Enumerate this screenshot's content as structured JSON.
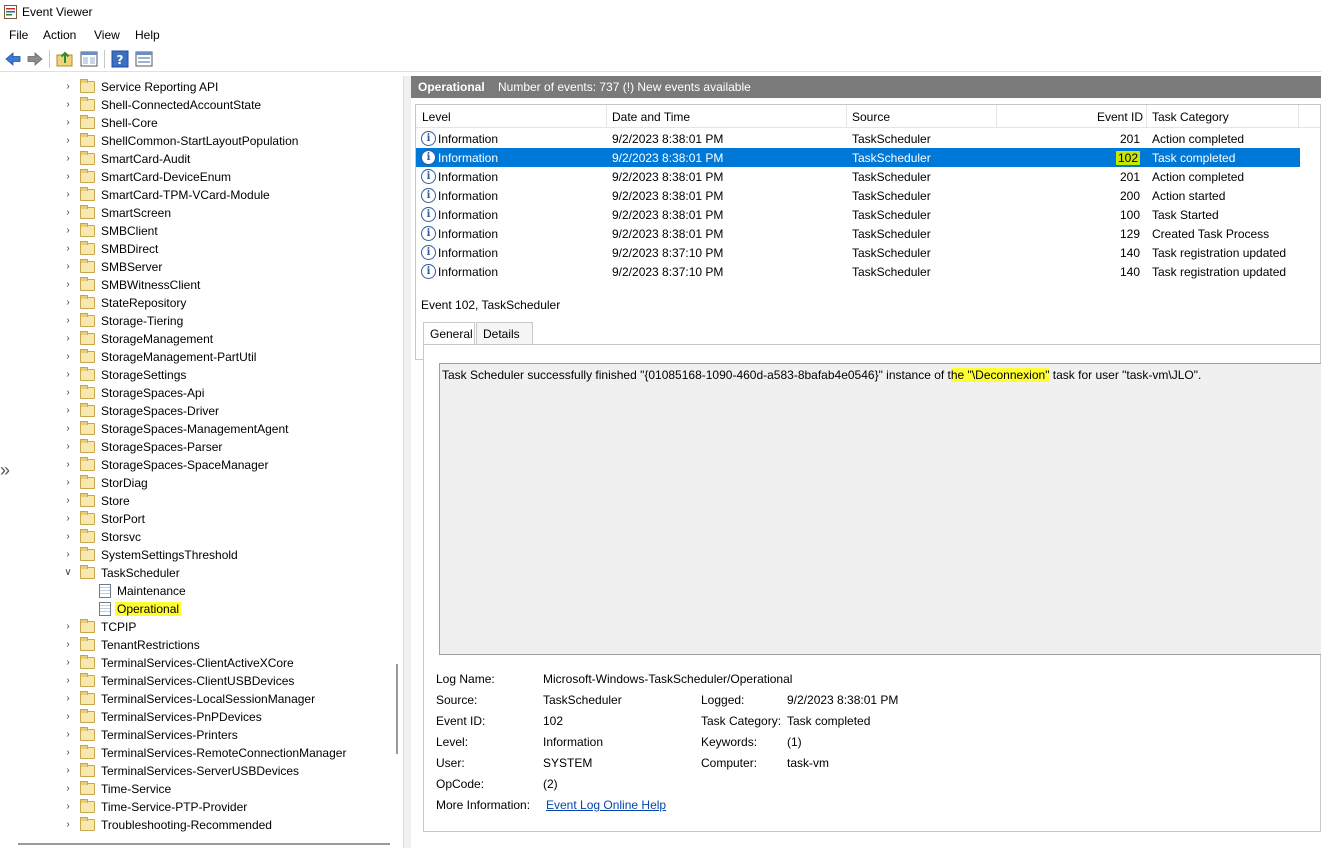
{
  "window": {
    "title": "Event Viewer"
  },
  "menu": [
    "File",
    "Action",
    "View",
    "Help"
  ],
  "toolbar": {
    "icons": [
      "back-arrow-icon",
      "forward-arrow-icon",
      "folder-up-icon",
      "properties-panel-icon",
      "help-icon",
      "show-pane-icon"
    ]
  },
  "tree": {
    "items": [
      {
        "label": "Service Reporting API",
        "expanded": false
      },
      {
        "label": "Shell-ConnectedAccountState",
        "expanded": false
      },
      {
        "label": "Shell-Core",
        "expanded": false
      },
      {
        "label": "ShellCommon-StartLayoutPopulation",
        "expanded": false
      },
      {
        "label": "SmartCard-Audit",
        "expanded": false
      },
      {
        "label": "SmartCard-DeviceEnum",
        "expanded": false
      },
      {
        "label": "SmartCard-TPM-VCard-Module",
        "expanded": false
      },
      {
        "label": "SmartScreen",
        "expanded": false
      },
      {
        "label": "SMBClient",
        "expanded": false
      },
      {
        "label": "SMBDirect",
        "expanded": false
      },
      {
        "label": "SMBServer",
        "expanded": false
      },
      {
        "label": "SMBWitnessClient",
        "expanded": false
      },
      {
        "label": "StateRepository",
        "expanded": false
      },
      {
        "label": "Storage-Tiering",
        "expanded": false
      },
      {
        "label": "StorageManagement",
        "expanded": false
      },
      {
        "label": "StorageManagement-PartUtil",
        "expanded": false
      },
      {
        "label": "StorageSettings",
        "expanded": false
      },
      {
        "label": "StorageSpaces-Api",
        "expanded": false
      },
      {
        "label": "StorageSpaces-Driver",
        "expanded": false
      },
      {
        "label": "StorageSpaces-ManagementAgent",
        "expanded": false
      },
      {
        "label": "StorageSpaces-Parser",
        "expanded": false
      },
      {
        "label": "StorageSpaces-SpaceManager",
        "expanded": false
      },
      {
        "label": "StorDiag",
        "expanded": false
      },
      {
        "label": "Store",
        "expanded": false
      },
      {
        "label": "StorPort",
        "expanded": false
      },
      {
        "label": "Storsvc",
        "expanded": false
      },
      {
        "label": "SystemSettingsThreshold",
        "expanded": false
      },
      {
        "label": "TaskScheduler",
        "expanded": true
      },
      {
        "label": "Maintenance",
        "child": true
      },
      {
        "label": "Operational",
        "child": true,
        "highlighted": true
      },
      {
        "label": "TCPIP",
        "expanded": false
      },
      {
        "label": "TenantRestrictions",
        "expanded": false
      },
      {
        "label": "TerminalServices-ClientActiveXCore",
        "expanded": false
      },
      {
        "label": "TerminalServices-ClientUSBDevices",
        "expanded": false
      },
      {
        "label": "TerminalServices-LocalSessionManager",
        "expanded": false
      },
      {
        "label": "TerminalServices-PnPDevices",
        "expanded": false
      },
      {
        "label": "TerminalServices-Printers",
        "expanded": false
      },
      {
        "label": "TerminalServices-RemoteConnectionManager",
        "expanded": false
      },
      {
        "label": "TerminalServices-ServerUSBDevices",
        "expanded": false
      },
      {
        "label": "Time-Service",
        "expanded": false
      },
      {
        "label": "Time-Service-PTP-Provider",
        "expanded": false
      },
      {
        "label": "Troubleshooting-Recommended",
        "expanded": false
      }
    ]
  },
  "log_header": {
    "name": "Operational",
    "count": "Number of events: 737 (!) New events available"
  },
  "events": {
    "columns": [
      "Level",
      "Date and Time",
      "Source",
      "Event ID",
      "Task Category"
    ],
    "rows": [
      {
        "level": "Information",
        "datetime": "9/2/2023 8:38:01 PM",
        "source": "TaskScheduler",
        "event_id": "201",
        "category": "Action completed"
      },
      {
        "level": "Information",
        "datetime": "9/2/2023 8:38:01 PM",
        "source": "TaskScheduler",
        "event_id": "102",
        "category": "Task completed",
        "selected": true
      },
      {
        "level": "Information",
        "datetime": "9/2/2023 8:38:01 PM",
        "source": "TaskScheduler",
        "event_id": "201",
        "category": "Action completed"
      },
      {
        "level": "Information",
        "datetime": "9/2/2023 8:38:01 PM",
        "source": "TaskScheduler",
        "event_id": "200",
        "category": "Action started"
      },
      {
        "level": "Information",
        "datetime": "9/2/2023 8:38:01 PM",
        "source": "TaskScheduler",
        "event_id": "100",
        "category": "Task Started"
      },
      {
        "level": "Information",
        "datetime": "9/2/2023 8:38:01 PM",
        "source": "TaskScheduler",
        "event_id": "129",
        "category": "Created Task Process"
      },
      {
        "level": "Information",
        "datetime": "9/2/2023 8:37:10 PM",
        "source": "TaskScheduler",
        "event_id": "140",
        "category": "Task registration updated"
      },
      {
        "level": "Information",
        "datetime": "9/2/2023 8:37:10 PM",
        "source": "TaskScheduler",
        "event_id": "140",
        "category": "Task registration updated"
      }
    ]
  },
  "detail": {
    "title": "Event 102, TaskScheduler",
    "tabs": [
      "General",
      "Details"
    ],
    "message_pre": "Task Scheduler successfully finished \"{01085168-1090-460d-a583-8bafab4e0546}\" instance of t",
    "message_hl": "he \"\\Deconnexion\"",
    "message_post": " task for user \"task-vm\\JLO\".",
    "props": {
      "log_name_k": "Log Name:",
      "log_name_v": "Microsoft-Windows-TaskScheduler/Operational",
      "source_k": "Source:",
      "source_v": "TaskScheduler",
      "logged_k": "Logged:",
      "logged_v": "9/2/2023 8:38:01 PM",
      "event_id_k": "Event ID:",
      "event_id_v": "102",
      "task_cat_k": "Task Category:",
      "task_cat_v": "Task completed",
      "level_k": "Level:",
      "level_v": "Information",
      "keywords_k": "Keywords:",
      "keywords_v": "(1)",
      "user_k": "User:",
      "user_v": "SYSTEM",
      "computer_k": "Computer:",
      "computer_v": "task-vm",
      "opcode_k": "OpCode:",
      "opcode_v": "(2)",
      "more_info_k": "More Information:",
      "more_info_v": "Event Log Online Help"
    }
  },
  "colors": {
    "selection": "#0078d7",
    "highlight": "#ffff33",
    "id_highlight": "#c7e600",
    "header_bar": "#7a7a7a"
  }
}
